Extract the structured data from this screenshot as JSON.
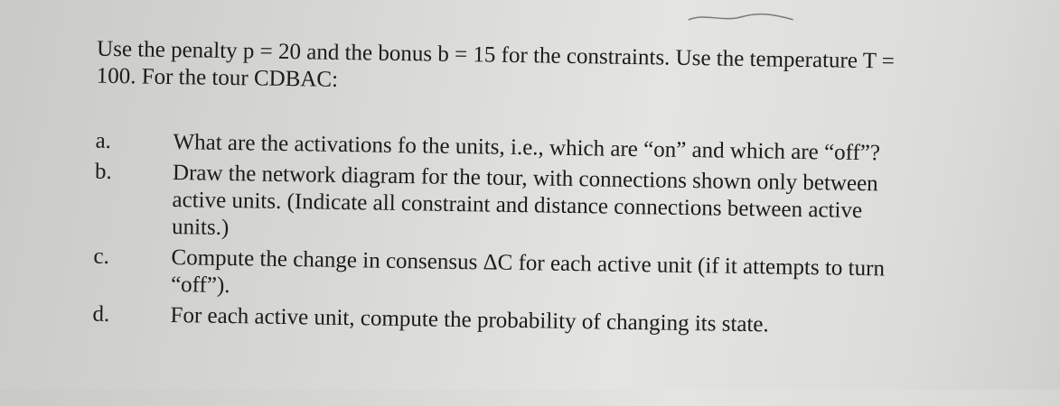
{
  "intro": {
    "line1": "Use the penalty p = 20 and the bonus b = 15 for the constraints. Use the temperature T =",
    "line2": "100. For the tour CDBAC:"
  },
  "items": [
    {
      "marker": "a.",
      "lines": [
        "What are the activations fo the units, i.e., which are “on” and which are “off”?"
      ]
    },
    {
      "marker": "b.",
      "lines": [
        "Draw the network diagram for the tour, with connections shown only between",
        "active units. (Indicate all constraint and distance connections between active",
        "units.)"
      ]
    },
    {
      "marker": "c.",
      "lines": [
        "Compute the change in consensus ΔC for each active unit (if it attempts to turn",
        "“off”)."
      ]
    },
    {
      "marker": "d.",
      "lines": [
        "For each active unit, compute the probability of changing its state."
      ]
    }
  ],
  "colors": {
    "ink": "#1c1c1c",
    "paper": "#e0e0dd"
  }
}
